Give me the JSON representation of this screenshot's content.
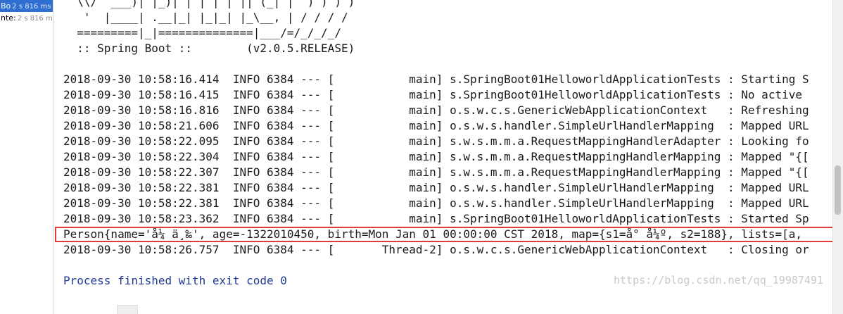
{
  "tests": [
    {
      "name": "Bo",
      "duration": "2 s 816 ms"
    },
    {
      "name": "nte:",
      "duration": "2 s 816 ms"
    }
  ],
  "banner": [
    "  \\\\/  ___)| |_)| | | | | || (_| |  ) ) ) )",
    "   '  |____| .__|_| |_|_| |_\\__, | / / / /",
    "  =========|_|==============|___/=/_/_/_/",
    "  :: Spring Boot ::        (v2.0.5.RELEASE)"
  ],
  "log_lines": [
    "2018-09-30 10:58:16.414  INFO 6384 --- [           main] s.SpringBoot01HelloworldApplicationTests : Starting S",
    "2018-09-30 10:58:16.415  INFO 6384 --- [           main] s.SpringBoot01HelloworldApplicationTests : No active",
    "2018-09-30 10:58:16.816  INFO 6384 --- [           main] o.s.w.c.s.GenericWebApplicationContext   : Refreshing",
    "2018-09-30 10:58:21.606  INFO 6384 --- [           main] o.s.w.s.handler.SimpleUrlHandlerMapping  : Mapped URL",
    "2018-09-30 10:58:22.095  INFO 6384 --- [           main] s.w.s.m.m.a.RequestMappingHandlerAdapter : Looking fo",
    "2018-09-30 10:58:22.304  INFO 6384 --- [           main] s.w.s.m.m.a.RequestMappingHandlerMapping : Mapped \"{[",
    "2018-09-30 10:58:22.307  INFO 6384 --- [           main] s.w.s.m.m.a.RequestMappingHandlerMapping : Mapped \"{[",
    "2018-09-30 10:58:22.381  INFO 6384 --- [           main] o.s.w.s.handler.SimpleUrlHandlerMapping  : Mapped URL",
    "2018-09-30 10:58:22.381  INFO 6384 --- [           main] o.s.w.s.handler.SimpleUrlHandlerMapping  : Mapped URL",
    "2018-09-30 10:58:23.362  INFO 6384 --- [           main] s.SpringBoot01HelloworldApplicationTests : Started Sp",
    "Person{name='å¼ ä¸‰', age=-1322010450, birth=Mon Jan 01 00:00:00 CST 2018, map={s1=å° å¼º, s2=188}, lists=[a,",
    "2018-09-30 10:58:26.757  INFO 6384 --- [       Thread-2] o.s.w.c.s.GenericWebApplicationContext   : Closing or"
  ],
  "process_finished": "Process finished with exit code 0",
  "watermark": "https://blog.csdn.net/qq_19987491",
  "colors": {
    "highlight_border": "#e23b3b",
    "process_text": "#1f3a93",
    "selected_row": "#2e6fd1"
  }
}
